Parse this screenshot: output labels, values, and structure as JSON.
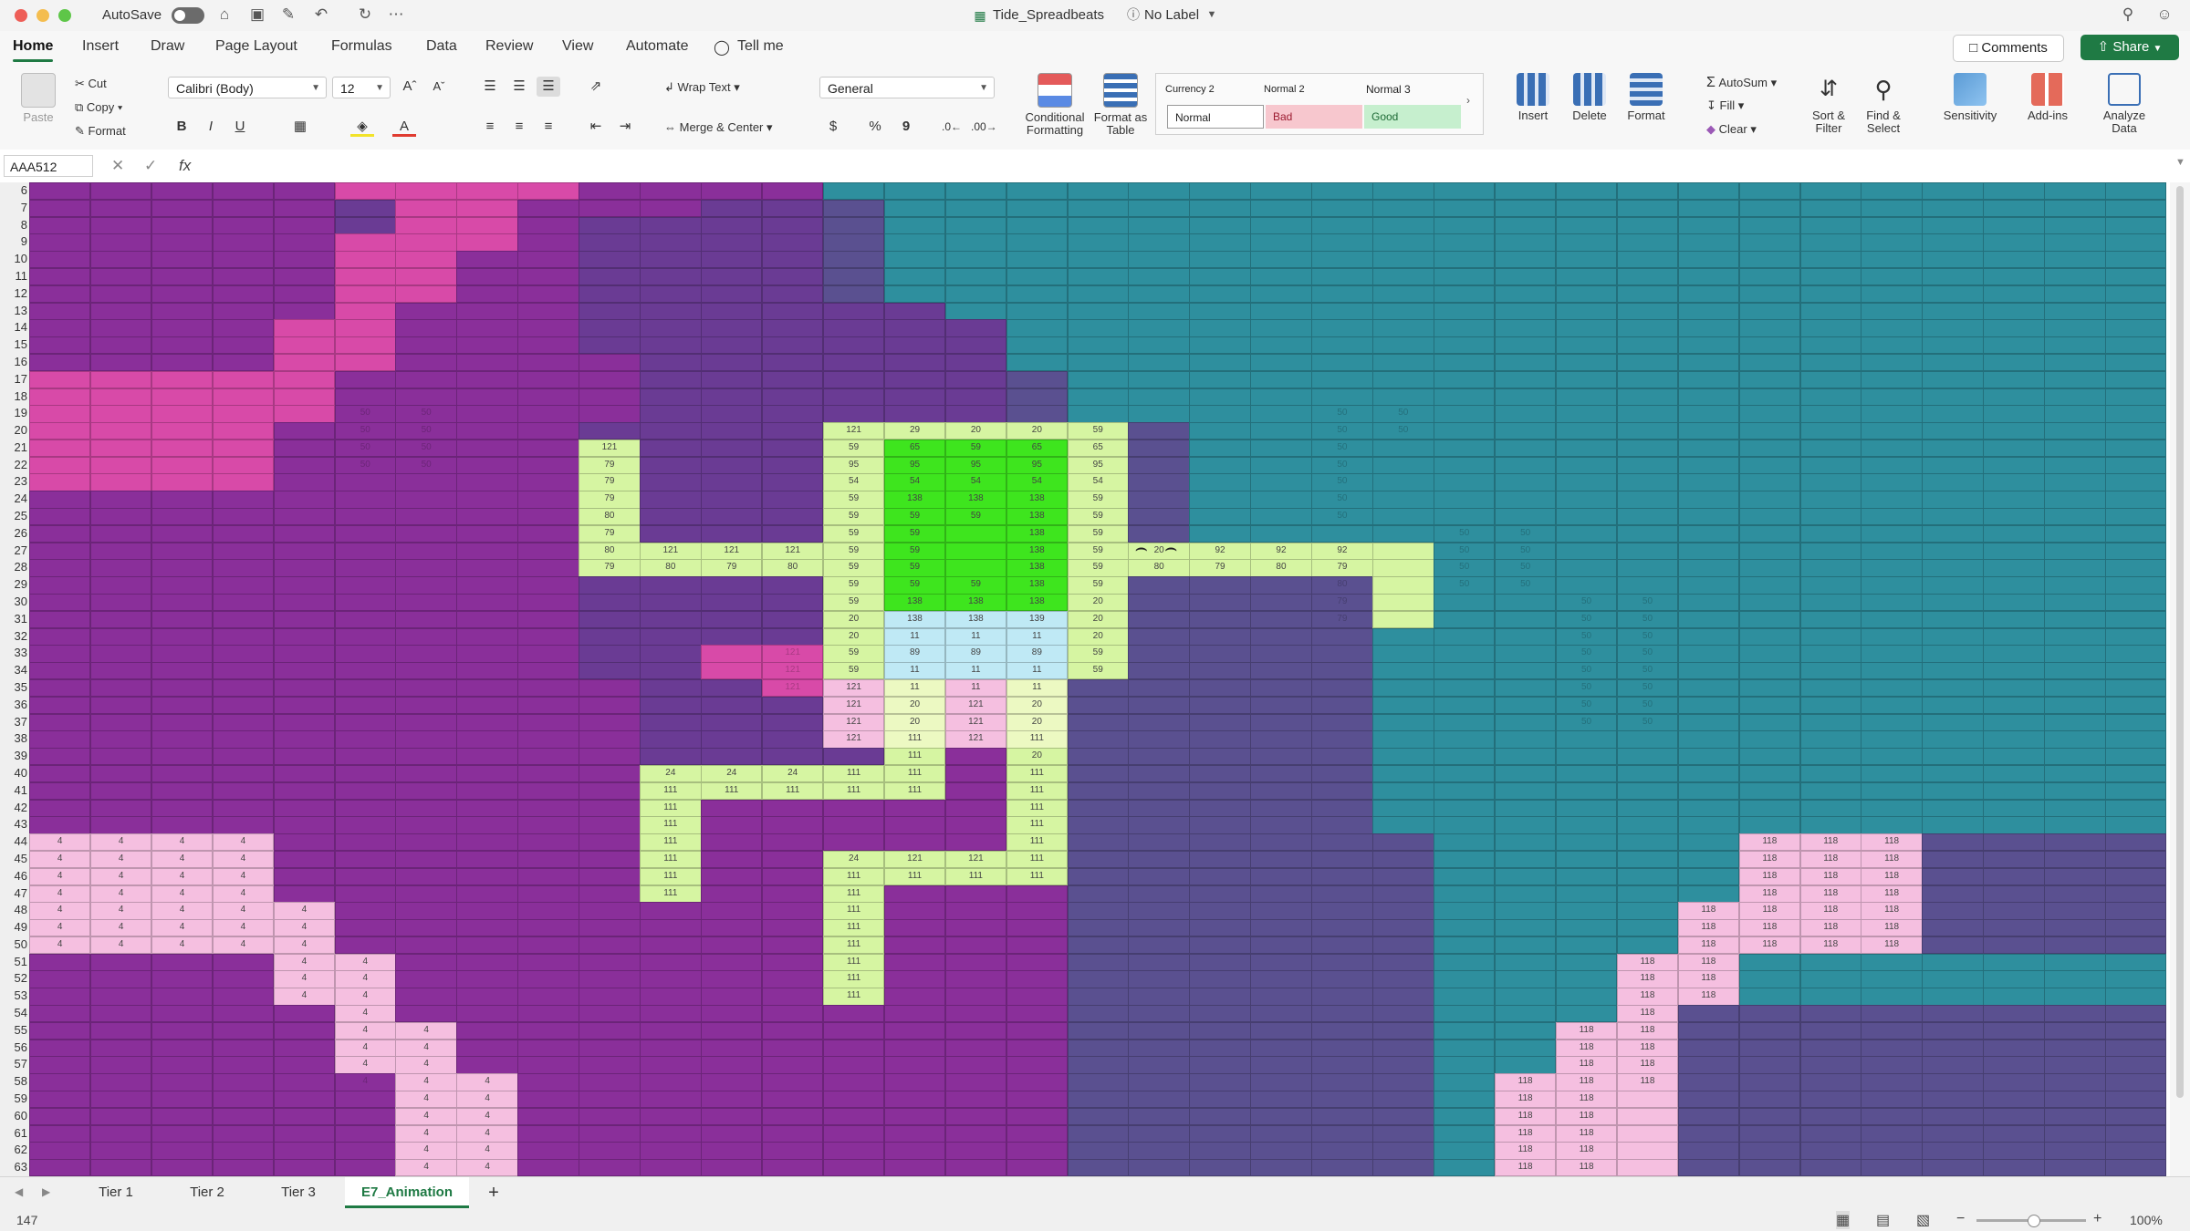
{
  "window": {
    "autosave_label": "AutoSave",
    "file_name": "Tide_Spreadbeats",
    "label_status": "No Label"
  },
  "ribbon_tabs": [
    "Home",
    "Insert",
    "Draw",
    "Page Layout",
    "Formulas",
    "Data",
    "Review",
    "View",
    "Automate"
  ],
  "tell_me": "Tell me",
  "header_buttons": {
    "comments": "Comments",
    "share": "Share"
  },
  "ribbon": {
    "paste": "Paste",
    "cut": "Cut",
    "copy": "Copy",
    "format_painter": "Format",
    "font_name": "Calibri (Body)",
    "font_size": "12",
    "bold": "B",
    "italic": "I",
    "underline": "U",
    "wrap_text": "Wrap Text",
    "merge_center": "Merge & Center",
    "number_format": "General",
    "currency": "$",
    "percent": "%",
    "comma": "9",
    "conditional_formatting": "Conditional Formatting",
    "format_as_table": "Format as Table",
    "styles": [
      {
        "name": "Currency 2",
        "bg": "#ffffff",
        "fg": "#333333"
      },
      {
        "name": "Normal 2",
        "bg": "#ffffff",
        "fg": "#333333"
      },
      {
        "name": "Normal 3",
        "bg": "#ffffff",
        "fg": "#333333"
      },
      {
        "name": "Normal",
        "bg": "#ffffff",
        "fg": "#333333"
      },
      {
        "name": "Bad",
        "bg": "#f7c7ce",
        "fg": "#9c1b30"
      },
      {
        "name": "Good",
        "bg": "#c6efce",
        "fg": "#1e6b36"
      }
    ],
    "insert": "Insert",
    "delete": "Delete",
    "format": "Format",
    "autosum": "AutoSum",
    "fill": "Fill",
    "clear": "Clear",
    "sort_filter": "Sort & Filter",
    "find_select": "Find & Select",
    "sensitivity": "Sensitivity",
    "add_ins": "Add-ins",
    "analyze_data": "Analyze Data"
  },
  "formula_bar": {
    "name_box": "AAA512",
    "fx": "fx",
    "formula": ""
  },
  "row_numbers": [
    6,
    7,
    8,
    9,
    10,
    11,
    12,
    13,
    14,
    15,
    16,
    17,
    18,
    19,
    20,
    21,
    22,
    23,
    24,
    25,
    26,
    27,
    28,
    29,
    30,
    31,
    32,
    33,
    34,
    35,
    36,
    37,
    38,
    39,
    40,
    41,
    42,
    43,
    44,
    45,
    46,
    47,
    48,
    49,
    50,
    51,
    52,
    53,
    54,
    55,
    56,
    57,
    58,
    59,
    60,
    61,
    62,
    63
  ],
  "palette": {
    "A": "#8a2f9a",
    "B": "#6a3b94",
    "C": "#5a5090",
    "D": "#3f7e94",
    "E": "#2e8f9e",
    "P": "#d84aa8",
    "p": "#f5bfe0",
    "G": "#3ee51e",
    "g": "#86e82e",
    "y": "#d6f5a2",
    "Y": "#ecf9c2",
    "L": "#bfe9f5",
    "W": "#e9f7e9"
  },
  "grid_rows": [
    "AAAAAPPPPAAAAEEEEEEEEEEEEEEEEEEEEEE",
    "AAAAABPPAAABBCEEEEEEEEEEEEEEEEEEEEE",
    "AAAAABPPABBBBCEEEEEEEEEEEEEEEEEEEEE",
    "AAAAAPPPABBBBCEEEEEEEEEEEEEEEEEEEEE",
    "AAAAAPPAABBBBCEEEEEEEEEEEEEEEEEEEEE",
    "AAAAAPPAABBBBCEEEEEEEEEEEEEEEEEEEEE",
    "AAAAAPPAABBBBCEEEEEEEEEEEEEEEEEEEEE",
    "AAAAAPAAABBBBBBEEEEEEEEEEEEEEEEEEEE",
    "AAAAPPAAABBBBBBBEEEEEEEEEEEEEEEEEEE",
    "AAAAPPAAABBBBBBBEEEEEEEEEEEEEEEEEEE",
    "AAAAPPAAAABBBBBBEEEEEEEEEEEEEEEEEEE",
    "PPPPPAAAAABBBBBBCEEEEEEEEEEEEEEEEEE",
    "PPPPPAAAAABBBBBBCEEEEEEEEEEEEEEEEEE",
    "PPPPPAAAAABBBBBBCEEEEEEEEEEEEEEEEEE",
    "PPPPAAAAABBBByyyyyCEEEEEEEEEEEEEEEE",
    "PPPPAAAAAyBBByGGGyCEEEEEEEEEEEEEEEE",
    "PPPPAAAAAyBBByGGGyCEEEEEEEEEEEEEEEE",
    "PPPPAAAAAyBBByGGGyCEEEEEEEEEEEEEEEE",
    "AAAAAAAAAyBBByGGGyCEEEEEEEEEEEEEEEE",
    "AAAAAAAAAyBBByGGGyCEEEEEEEEEEEEEEEE",
    "AAAAAAAAAyBBByGGGyCEEEEEEEEEEEEEEEE",
    "AAAAAAAAAyyyyyGGGyyyyyyEEEEEEEEEEEE",
    "AAAAAAAAAyyyyyGGGyyyyyyEEEEEEEEEEEE",
    "AAAAAAAAABBBByGGGyCCCCyEEEEEEEEEEEE",
    "AAAAAAAAABBBByGGGyCCCCyEEEEEEEEEEEE",
    "AAAAAAAAABBBByLLLyCCCCyEEEEEEEEEEEE",
    "AAAAAAAAABBBByLLLyCCCCEEEEEEEEEEEEE",
    "AAAAAAAAABBPPyLLLyCCCCEEEEEEEEEEEEE",
    "AAAAAAAAABBPPyLLLyCCCCEEEEEEEEEEEEE",
    "AAAAAAAAAABBPpYpYCCCCCEEEEEEEEEEEEE",
    "AAAAAAAAAABBBpYpYCCCCCEEEEEEEEEEEEE",
    "AAAAAAAAAABBBpYpYCCCCCEEEEEEEEEEEEE",
    "AAAAAAAAAABBBpYpYCCCCCEEEEEEEEEEEEE",
    "AAAAAAAAAABBBByAyCCCCCEEEEEEEEEEEEE",
    "AAAAAAAAAAyyyyyAyCCCCCEEEEEEEEEEEEE",
    "AAAAAAAAAAyyyyyAyCCCCCEEEEEEEEEEEEE",
    "AAAAAAAAAAyAAAAAyCCCCCEEEEEEEEEEEEE",
    "AAAAAAAAAAyAAAAAyCCCCCEEEEEEEEEEEEE",
    "ppppAAAAAAyAAAAAyCCCCCCEEEEEpppCCCC",
    "ppppAAAAAAyAAyyyyCCCCCCEEEEEpppCCCC",
    "ppppAAAAAAyAAyyyyCCCCCCEEEEEpppCCCC",
    "ppppAAAAAAyAAyAAACCCCCCEEEEEpppCCCC",
    "pppppAAAAAAAAyAAACCCCCCEEEEppppCCCC",
    "pppppAAAAAAAAyAAACCCCCCEEEEppppCCCC",
    "pppppAAAAAAAAyAAACCCCCCEEEEppppCCCC",
    "AAAAppAAAAAAAyAAACCCCCCEEEppEEEEEEE",
    "AAAAppAAAAAAAyAAACCCCCCEEEppEEEEEEE",
    "AAAAppAAAAAAAyAAACCCCCCEEEppEEEEEEE",
    "AAAAApAAAAAAAAAAACCCCCCEEEpCCCCCCCC",
    "AAAAAppAAAAAAAAAACCCCCCEEppCCCCCCCC",
    "AAAAAppAAAAAAAAAACCCCCCEEppCCCCCCCC",
    "AAAAAppAAAAAAAAAACCCCCCEEppCCCCCCCC",
    "AAAAAAppAAAAAAAAACCCCCCEpppCCCCCCCC",
    "AAAAAAppAAAAAAAAACCCCCCEpppCCCCCCCC",
    "AAAAAAppAAAAAAAAACCCCCCEpppCCCCCCCC",
    "AAAAAAppAAAAAAAAACCCCCCEpppCCCCCCCC",
    "AAAAAAppAAAAAAAAACCCCCCEpppCCCCCCCC",
    "AAAAAAppAAAAAAAAACCCCCCEpppCCCCCCCC"
  ],
  "grid_values": [
    [
      19,
      5,
      50
    ],
    [
      19,
      6,
      50
    ],
    [
      19,
      21,
      50
    ],
    [
      19,
      22,
      50
    ],
    [
      20,
      5,
      50
    ],
    [
      20,
      6,
      50
    ],
    [
      20,
      21,
      50
    ],
    [
      20,
      22,
      50
    ],
    [
      21,
      5,
      50
    ],
    [
      21,
      6,
      50
    ],
    [
      21,
      21,
      50
    ],
    [
      22,
      5,
      50
    ],
    [
      22,
      6,
      50
    ],
    [
      22,
      21,
      50
    ],
    [
      23,
      21,
      50
    ],
    [
      24,
      21,
      50
    ],
    [
      25,
      21,
      50
    ],
    [
      26,
      23,
      50
    ],
    [
      26,
      24,
      50
    ],
    [
      27,
      23,
      50
    ],
    [
      27,
      24,
      50
    ],
    [
      28,
      23,
      50
    ],
    [
      28,
      24,
      50
    ],
    [
      29,
      23,
      50
    ],
    [
      29,
      24,
      50
    ],
    [
      30,
      25,
      50
    ],
    [
      30,
      26,
      50
    ],
    [
      31,
      25,
      50
    ],
    [
      31,
      26,
      50
    ],
    [
      32,
      25,
      50
    ],
    [
      32,
      26,
      50
    ],
    [
      33,
      25,
      50
    ],
    [
      33,
      26,
      50
    ],
    [
      34,
      25,
      50
    ],
    [
      34,
      26,
      50
    ],
    [
      35,
      25,
      50
    ],
    [
      35,
      26,
      50
    ],
    [
      36,
      25,
      50
    ],
    [
      36,
      26,
      50
    ],
    [
      37,
      25,
      50
    ],
    [
      37,
      26,
      50
    ],
    [
      20,
      13,
      121
    ],
    [
      20,
      14,
      29
    ],
    [
      20,
      15,
      20
    ],
    [
      20,
      16,
      20
    ],
    [
      20,
      17,
      59
    ],
    [
      21,
      9,
      121
    ],
    [
      21,
      13,
      59
    ],
    [
      21,
      14,
      65
    ],
    [
      21,
      15,
      59
    ],
    [
      21,
      16,
      65
    ],
    [
      21,
      17,
      65
    ],
    [
      22,
      9,
      79
    ],
    [
      22,
      13,
      95
    ],
    [
      22,
      14,
      95
    ],
    [
      22,
      15,
      95
    ],
    [
      22,
      16,
      95
    ],
    [
      22,
      17,
      95
    ],
    [
      23,
      9,
      79
    ],
    [
      23,
      13,
      54
    ],
    [
      23,
      14,
      54
    ],
    [
      23,
      15,
      54
    ],
    [
      23,
      16,
      54
    ],
    [
      23,
      17,
      54
    ],
    [
      24,
      9,
      79
    ],
    [
      24,
      13,
      59
    ],
    [
      24,
      14,
      138
    ],
    [
      24,
      15,
      138
    ],
    [
      24,
      16,
      138
    ],
    [
      24,
      17,
      59
    ],
    [
      25,
      9,
      80
    ],
    [
      25,
      13,
      59
    ],
    [
      25,
      14,
      59
    ],
    [
      25,
      15,
      59
    ],
    [
      25,
      16,
      138
    ],
    [
      25,
      17,
      59
    ],
    [
      26,
      9,
      79
    ],
    [
      26,
      13,
      59
    ],
    [
      26,
      14,
      59
    ],
    [
      26,
      16,
      138
    ],
    [
      26,
      17,
      59
    ],
    [
      27,
      9,
      80
    ],
    [
      27,
      10,
      121
    ],
    [
      27,
      11,
      121
    ],
    [
      27,
      12,
      121
    ],
    [
      27,
      13,
      59
    ],
    [
      27,
      14,
      59
    ],
    [
      27,
      16,
      138
    ],
    [
      27,
      17,
      59
    ],
    [
      27,
      18,
      20
    ],
    [
      27,
      19,
      92
    ],
    [
      27,
      20,
      92
    ],
    [
      27,
      21,
      92
    ],
    [
      28,
      9,
      79
    ],
    [
      28,
      10,
      80
    ],
    [
      28,
      11,
      79
    ],
    [
      28,
      12,
      80
    ],
    [
      28,
      13,
      59
    ],
    [
      28,
      14,
      59
    ],
    [
      28,
      16,
      138
    ],
    [
      28,
      17,
      59
    ],
    [
      28,
      18,
      80
    ],
    [
      28,
      19,
      79
    ],
    [
      28,
      20,
      80
    ],
    [
      28,
      21,
      79
    ],
    [
      29,
      13,
      59
    ],
    [
      29,
      14,
      59
    ],
    [
      29,
      15,
      59
    ],
    [
      29,
      16,
      138
    ],
    [
      29,
      17,
      59
    ],
    [
      29,
      21,
      80
    ],
    [
      30,
      13,
      59
    ],
    [
      30,
      14,
      138
    ],
    [
      30,
      15,
      138
    ],
    [
      30,
      16,
      138
    ],
    [
      30,
      17,
      20
    ],
    [
      30,
      21,
      79
    ],
    [
      31,
      13,
      20
    ],
    [
      31,
      14,
      138
    ],
    [
      31,
      15,
      138
    ],
    [
      31,
      16,
      139
    ],
    [
      31,
      17,
      20
    ],
    [
      31,
      21,
      79
    ],
    [
      32,
      13,
      20
    ],
    [
      32,
      14,
      11
    ],
    [
      32,
      15,
      11
    ],
    [
      32,
      16,
      11
    ],
    [
      32,
      17,
      20
    ],
    [
      33,
      12,
      121
    ],
    [
      33,
      13,
      59
    ],
    [
      33,
      14,
      89
    ],
    [
      33,
      15,
      89
    ],
    [
      33,
      16,
      89
    ],
    [
      33,
      17,
      59
    ],
    [
      34,
      12,
      121
    ],
    [
      34,
      13,
      59
    ],
    [
      34,
      14,
      11
    ],
    [
      34,
      15,
      11
    ],
    [
      34,
      16,
      11
    ],
    [
      34,
      17,
      59
    ],
    [
      35,
      12,
      121
    ],
    [
      35,
      13,
      121
    ],
    [
      35,
      14,
      11
    ],
    [
      35,
      15,
      11
    ],
    [
      35,
      16,
      11
    ],
    [
      36,
      13,
      121
    ],
    [
      36,
      14,
      20
    ],
    [
      36,
      15,
      121
    ],
    [
      36,
      16,
      20
    ],
    [
      37,
      13,
      121
    ],
    [
      37,
      14,
      20
    ],
    [
      37,
      15,
      121
    ],
    [
      37,
      16,
      20
    ],
    [
      38,
      13,
      121
    ],
    [
      38,
      14,
      111
    ],
    [
      38,
      15,
      121
    ],
    [
      38,
      16,
      111
    ],
    [
      39,
      14,
      111
    ],
    [
      39,
      16,
      20
    ],
    [
      40,
      10,
      24
    ],
    [
      40,
      11,
      24
    ],
    [
      40,
      12,
      24
    ],
    [
      40,
      13,
      111
    ],
    [
      40,
      14,
      111
    ],
    [
      40,
      16,
      111
    ],
    [
      41,
      10,
      111
    ],
    [
      41,
      11,
      111
    ],
    [
      41,
      12,
      111
    ],
    [
      41,
      13,
      111
    ],
    [
      41,
      14,
      111
    ],
    [
      41,
      16,
      111
    ],
    [
      42,
      10,
      111
    ],
    [
      42,
      16,
      111
    ],
    [
      43,
      10,
      111
    ],
    [
      43,
      16,
      111
    ],
    [
      44,
      0,
      4
    ],
    [
      44,
      1,
      4
    ],
    [
      44,
      2,
      4
    ],
    [
      44,
      3,
      4
    ],
    [
      44,
      10,
      111
    ],
    [
      44,
      16,
      111
    ],
    [
      44,
      28,
      118
    ],
    [
      44,
      29,
      118
    ],
    [
      44,
      30,
      118
    ],
    [
      45,
      0,
      4
    ],
    [
      45,
      1,
      4
    ],
    [
      45,
      2,
      4
    ],
    [
      45,
      3,
      4
    ],
    [
      45,
      10,
      111
    ],
    [
      45,
      13,
      24
    ],
    [
      45,
      14,
      121
    ],
    [
      45,
      15,
      121
    ],
    [
      45,
      16,
      111
    ],
    [
      45,
      28,
      118
    ],
    [
      45,
      29,
      118
    ],
    [
      45,
      30,
      118
    ],
    [
      46,
      0,
      4
    ],
    [
      46,
      1,
      4
    ],
    [
      46,
      2,
      4
    ],
    [
      46,
      3,
      4
    ],
    [
      46,
      10,
      111
    ],
    [
      46,
      13,
      111
    ],
    [
      46,
      14,
      111
    ],
    [
      46,
      15,
      111
    ],
    [
      46,
      16,
      111
    ],
    [
      46,
      28,
      118
    ],
    [
      46,
      29,
      118
    ],
    [
      46,
      30,
      118
    ],
    [
      47,
      0,
      4
    ],
    [
      47,
      1,
      4
    ],
    [
      47,
      2,
      4
    ],
    [
      47,
      3,
      4
    ],
    [
      47,
      10,
      111
    ],
    [
      47,
      13,
      111
    ],
    [
      47,
      28,
      118
    ],
    [
      47,
      29,
      118
    ],
    [
      47,
      30,
      118
    ],
    [
      48,
      0,
      4
    ],
    [
      48,
      1,
      4
    ],
    [
      48,
      2,
      4
    ],
    [
      48,
      3,
      4
    ],
    [
      48,
      4,
      4
    ],
    [
      48,
      13,
      111
    ],
    [
      48,
      27,
      118
    ],
    [
      48,
      28,
      118
    ],
    [
      48,
      29,
      118
    ],
    [
      48,
      30,
      118
    ],
    [
      49,
      0,
      4
    ],
    [
      49,
      1,
      4
    ],
    [
      49,
      2,
      4
    ],
    [
      49,
      3,
      4
    ],
    [
      49,
      4,
      4
    ],
    [
      49,
      13,
      111
    ],
    [
      49,
      27,
      118
    ],
    [
      49,
      28,
      118
    ],
    [
      49,
      29,
      118
    ],
    [
      49,
      30,
      118
    ],
    [
      50,
      0,
      4
    ],
    [
      50,
      1,
      4
    ],
    [
      50,
      2,
      4
    ],
    [
      50,
      3,
      4
    ],
    [
      50,
      4,
      4
    ],
    [
      50,
      13,
      111
    ],
    [
      50,
      27,
      118
    ],
    [
      50,
      28,
      118
    ],
    [
      50,
      29,
      118
    ],
    [
      50,
      30,
      118
    ],
    [
      51,
      4,
      4
    ],
    [
      51,
      5,
      4
    ],
    [
      51,
      13,
      111
    ],
    [
      51,
      26,
      118
    ],
    [
      51,
      27,
      118
    ],
    [
      52,
      4,
      4
    ],
    [
      52,
      5,
      4
    ],
    [
      52,
      13,
      111
    ],
    [
      52,
      26,
      118
    ],
    [
      52,
      27,
      118
    ],
    [
      53,
      4,
      4
    ],
    [
      53,
      5,
      4
    ],
    [
      53,
      13,
      111
    ],
    [
      53,
      26,
      118
    ],
    [
      53,
      27,
      118
    ],
    [
      54,
      5,
      4
    ],
    [
      54,
      26,
      118
    ],
    [
      55,
      5,
      4
    ],
    [
      55,
      6,
      4
    ],
    [
      55,
      25,
      118
    ],
    [
      55,
      26,
      118
    ],
    [
      56,
      5,
      4
    ],
    [
      56,
      6,
      4
    ],
    [
      56,
      25,
      118
    ],
    [
      56,
      26,
      118
    ],
    [
      57,
      5,
      4
    ],
    [
      57,
      6,
      4
    ],
    [
      57,
      25,
      118
    ],
    [
      57,
      26,
      118
    ],
    [
      58,
      5,
      4
    ],
    [
      58,
      6,
      4
    ],
    [
      58,
      7,
      4
    ],
    [
      58,
      24,
      118
    ],
    [
      58,
      25,
      118
    ],
    [
      58,
      26,
      118
    ],
    [
      59,
      6,
      4
    ],
    [
      59,
      7,
      4
    ],
    [
      59,
      24,
      118
    ],
    [
      59,
      25,
      118
    ],
    [
      60,
      6,
      4
    ],
    [
      60,
      7,
      4
    ],
    [
      60,
      24,
      118
    ],
    [
      60,
      25,
      118
    ],
    [
      61,
      6,
      4
    ],
    [
      61,
      7,
      4
    ],
    [
      61,
      24,
      118
    ],
    [
      61,
      25,
      118
    ],
    [
      62,
      6,
      4
    ],
    [
      62,
      7,
      4
    ],
    [
      62,
      24,
      118
    ],
    [
      62,
      25,
      118
    ],
    [
      63,
      6,
      4
    ],
    [
      63,
      7,
      4
    ],
    [
      63,
      24,
      118
    ],
    [
      63,
      25,
      118
    ]
  ],
  "smiley": "⌢ ⌢",
  "sheet_tabs": [
    {
      "label": "Tier 1",
      "active": false
    },
    {
      "label": "Tier 2",
      "active": false
    },
    {
      "label": "Tier 3",
      "active": false
    },
    {
      "label": "E7_Animation",
      "active": true
    }
  ],
  "add_sheet": "+",
  "status": {
    "left_value": "147",
    "zoom": "100%"
  }
}
